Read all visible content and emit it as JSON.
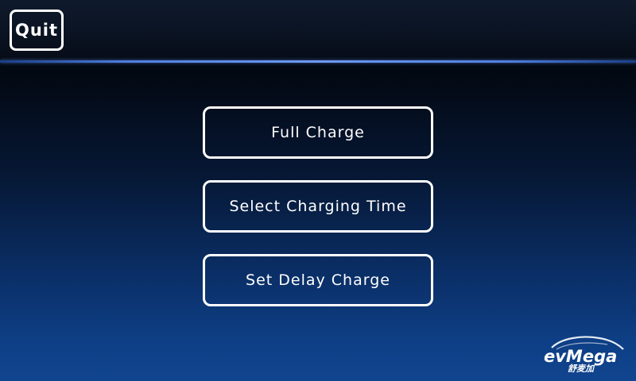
{
  "header": {
    "quit_label": "Quit"
  },
  "menu": {
    "items": [
      {
        "label": "Full Charge"
      },
      {
        "label": "Select Charging Time"
      },
      {
        "label": "Set Delay Charge"
      }
    ]
  },
  "brand": {
    "logo_text": "evMega",
    "logo_subtext": "舒麦加"
  },
  "colors": {
    "accent_line": "#6f9af2",
    "button_border": "#ffffff",
    "text": "#ffffff"
  }
}
